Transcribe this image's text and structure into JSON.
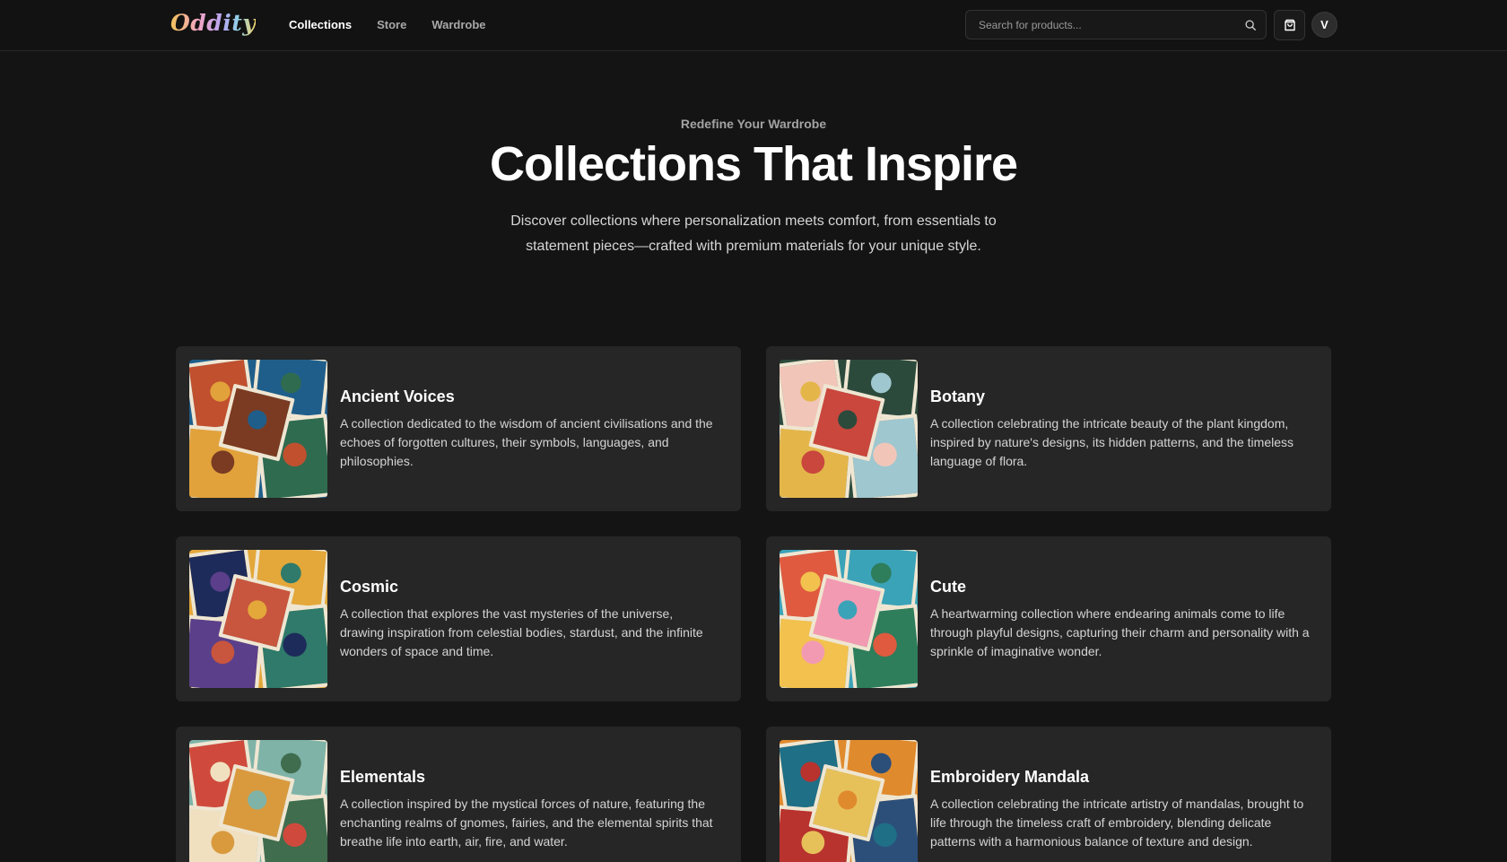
{
  "header": {
    "logo": "Oddity",
    "nav": [
      {
        "label": "Collections",
        "active": true
      },
      {
        "label": "Store",
        "active": false
      },
      {
        "label": "Wardrobe",
        "active": false
      }
    ],
    "search_placeholder": "Search for products...",
    "avatar_initial": "V"
  },
  "hero": {
    "eyebrow": "Redefine Your Wardrobe",
    "title": "Collections That Inspire",
    "subtitle": "Discover collections where personalization meets comfort, from essentials to statement pieces—crafted with premium materials for your unique style."
  },
  "collections": [
    {
      "title": "Ancient Voices",
      "description": "A collection dedicated to the wisdom of ancient civilisations and the echoes of forgotten cultures, their symbols, languages, and philosophies.",
      "palette": [
        "#c1502e",
        "#1f5e8a",
        "#e2a23b",
        "#2f6b4f",
        "#7a3b22"
      ]
    },
    {
      "title": "Botany",
      "description": "A collection celebrating the intricate beauty of the plant kingdom, inspired by nature's designs, its hidden patterns, and the timeless language of flora.",
      "palette": [
        "#f1c6b8",
        "#2c4a3c",
        "#e4b64a",
        "#9fc7cf",
        "#c9473d"
      ]
    },
    {
      "title": "Cosmic",
      "description": "A collection that explores the vast mysteries of the universe, drawing inspiration from celestial bodies, stardust, and the infinite wonders of space and time.",
      "palette": [
        "#1d2b5a",
        "#e3a73a",
        "#5b3f8a",
        "#2f7a6a",
        "#c8553d"
      ]
    },
    {
      "title": "Cute",
      "description": "A heartwarming collection where endearing animals come to life through playful designs, capturing their charm and personality with a sprinkle of imaginative wonder.",
      "palette": [
        "#e05a3f",
        "#3aa3b8",
        "#f2c14e",
        "#2e7d5b",
        "#f39ab3"
      ]
    },
    {
      "title": "Elementals",
      "description": "A collection inspired by the mystical forces of nature, featuring the enchanting realms of gnomes, fairies, and the elemental spirits that breathe life into earth, air, fire, and water.",
      "palette": [
        "#cf4a3c",
        "#7fb3a8",
        "#f0e0c0",
        "#3f6d4e",
        "#d99a3e"
      ]
    },
    {
      "title": "Embroidery Mandala",
      "description": "A collection celebrating the intricate artistry of mandalas, brought to life through the timeless craft of embroidery, blending delicate patterns with a harmonious balance of texture and design.",
      "palette": [
        "#1f6f86",
        "#e08a2e",
        "#b8322e",
        "#2c4f7a",
        "#e6c15a"
      ]
    }
  ]
}
